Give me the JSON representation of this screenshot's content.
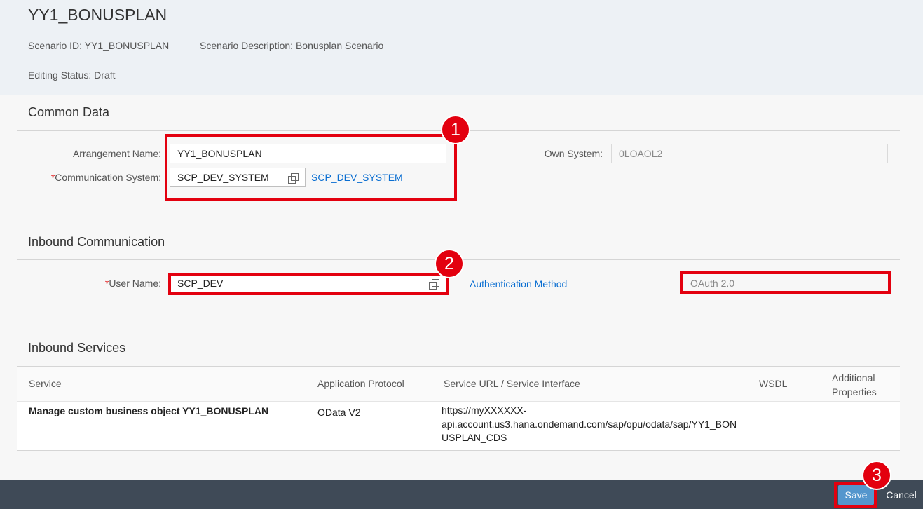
{
  "header": {
    "title": "YY1_BONUSPLAN",
    "scenario_id": "Scenario ID: YY1_BONUSPLAN",
    "scenario_description": "Scenario Description: Bonusplan Scenario",
    "editing_status": "Editing Status: Draft"
  },
  "common_data": {
    "title": "Common Data",
    "arrangement_name_label": "Arrangement Name:",
    "arrangement_name_value": "YY1_BONUSPLAN",
    "required_marker": "*",
    "communication_system_label": "Communication System:",
    "communication_system_value": "SCP_DEV_SYSTEM",
    "communication_system_link": "SCP_DEV_SYSTEM",
    "own_system_label": "Own System:",
    "own_system_value": "0LOAOL2"
  },
  "inbound_communication": {
    "title": "Inbound Communication",
    "user_name_label": "User Name:",
    "user_name_value": "SCP_DEV",
    "auth_method_link": "Authentication Method",
    "auth_method_value": "OAuth 2.0"
  },
  "inbound_services": {
    "title": "Inbound Services",
    "columns": [
      "Service",
      "Application Protocol",
      "Service URL / Service Interface",
      "WSDL",
      "Additional Properties"
    ],
    "rows": [
      {
        "service": "Manage custom business object YY1_BONUSPLAN",
        "protocol": "OData V2",
        "url_line1": "https://myXXXXXX-",
        "url_line2": "api.account.us3.hana.ondemand.com/sap/opu/odata/sap/YY1_BON",
        "url_line3": "USPLAN_CDS"
      }
    ]
  },
  "annotations": {
    "step1": "1",
    "step2": "2",
    "step3": "3",
    "highlight_color": "#e3000f"
  },
  "footer": {
    "save_label": "Save",
    "cancel_label": "Cancel"
  }
}
